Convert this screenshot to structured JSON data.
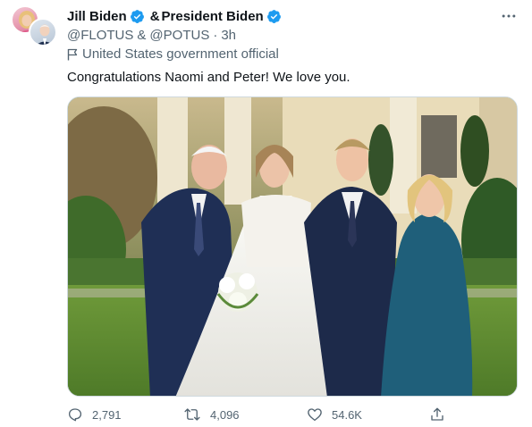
{
  "tweet": {
    "author1": {
      "name": "Jill Biden",
      "handle": "@FLOTUS"
    },
    "conjunction": "&",
    "author2": {
      "name": "President Biden",
      "handle": "@POTUS"
    },
    "handles_separator": "&",
    "time_dot": "·",
    "time": "3h",
    "label": "United States government official",
    "text": "Congratulations Naomi and Peter! We love you.",
    "more_icon": "more-horizontal-icon",
    "verified_icon": "verified-badge-icon",
    "flag_icon": "flag-icon"
  },
  "actions": {
    "replies": "2,791",
    "retweets": "4,096",
    "likes": "54.6K",
    "reply_icon": "reply-icon",
    "retweet_icon": "retweet-icon",
    "like_icon": "heart-icon",
    "share_icon": "share-icon"
  },
  "colors": {
    "verified": "#1d9bf0",
    "secondary_text": "#536471",
    "primary_text": "#0f1419"
  }
}
